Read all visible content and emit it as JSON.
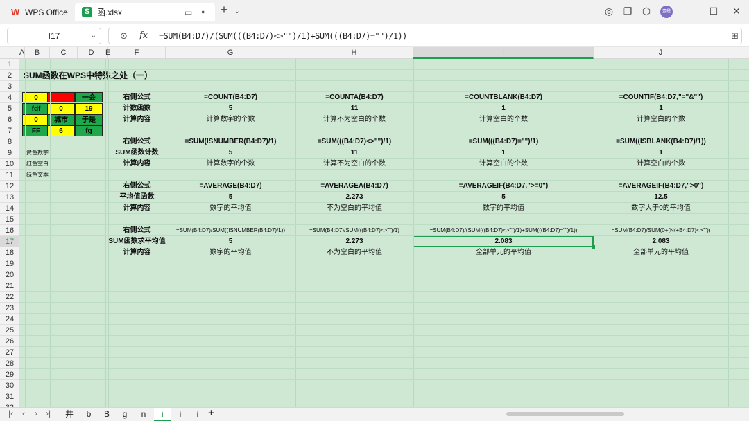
{
  "titlebar": {
    "app_tab": "WPS Office",
    "file_tab": "函.xlsx",
    "avatar_text": "壹橙"
  },
  "formula_bar": {
    "name_box": "I17",
    "formula": "=SUM(B4:D7)/(SUM(((B4:D7)<>\"\")/1)+SUM(((B4:D7)=\"\")/1))"
  },
  "columns": [
    "A",
    "B",
    "C",
    "D",
    "E",
    "F",
    "G",
    "H",
    "I",
    "J"
  ],
  "rows": [
    "1",
    "2",
    "3",
    "4",
    "5",
    "6",
    "7",
    "8",
    "9",
    "10",
    "11",
    "12",
    "13",
    "14",
    "15",
    "16",
    "17",
    "18",
    "19",
    "20",
    "21",
    "22",
    "23",
    "24",
    "25",
    "26",
    "27",
    "28",
    "29",
    "30",
    "31",
    "32"
  ],
  "title": "SUM函数在WPS中特殊之处（一）",
  "sample_table": [
    [
      "0",
      "",
      "一会"
    ],
    [
      "fdf",
      "0",
      "19"
    ],
    [
      "0",
      "城市",
      "于是"
    ],
    [
      "FF",
      "6",
      "fg"
    ]
  ],
  "legend": [
    "黄色数字",
    "红色空白",
    "绿色文本"
  ],
  "blocks": [
    {
      "labels": [
        "右侧公式",
        "计数函数",
        "计算内容"
      ],
      "formulas": [
        "=COUNT(B4:D7)",
        "=COUNTA(B4:D7)",
        "=COUNTBLANK(B4:D7)",
        "=COUNTIF(B4:D7,\"=\"&\"\")"
      ],
      "values": [
        "5",
        "11",
        "1",
        "1"
      ],
      "desc": [
        "计算数字的个数",
        "计算不为空白的个数",
        "计算空白的个数",
        "计算空白的个数"
      ]
    },
    {
      "labels": [
        "右侧公式",
        "SUM函数计数",
        "计算内容"
      ],
      "formulas": [
        "=SUM(ISNUMBER(B4:D7)/1)",
        "=SUM(((B4:D7)<>\"\")/1)",
        "=SUM(((B4:D7)=\"\")/1)",
        "=SUM((ISBLANK(B4:D7)/1))"
      ],
      "values": [
        "5",
        "11",
        "1",
        "1"
      ],
      "desc": [
        "计算数字的个数",
        "计算不为空白的个数",
        "计算空白的个数",
        "计算空白的个数"
      ]
    },
    {
      "labels": [
        "右侧公式",
        "平均值函数",
        "计算内容"
      ],
      "formulas": [
        "=AVERAGE(B4:D7)",
        "=AVERAGEA(B4:D7)",
        "=AVERAGEIF(B4:D7,\">=0\")",
        "=AVERAGEIF(B4:D7,\">0\")"
      ],
      "values": [
        "5",
        "2.273",
        "5",
        "12.5"
      ],
      "desc": [
        "数字的平均值",
        "不为空白的平均值",
        "数字的平均值",
        "数字大于0的平均值"
      ]
    },
    {
      "labels": [
        "右侧公式",
        "SUM函数求平均值",
        "计算内容"
      ],
      "formulas": [
        "=SUM(B4:D7)/SUM((ISNUMBER(B4:D7)/1))",
        "=SUM(B4:D7)/SUM(((B4:D7)<>\"\")/1)",
        "=SUM(B4:D7)/(SUM(((B4:D7)<>\"\")/1)+SUM(((B4:D7)=\"\")/1))",
        "=SUM(B4:D7)/SUM(0+(N(+B4:D7)<>\"\"))"
      ],
      "values": [
        "5",
        "2.273",
        "2.083",
        "2.083"
      ],
      "desc": [
        "数字的平均值",
        "不为空白的平均值",
        "全部单元的平均值",
        "全部单元的平均值"
      ]
    }
  ],
  "sheets": [
    "井",
    "b",
    "B",
    "g",
    "n",
    "i",
    "i",
    "i"
  ],
  "active_sheet_index": 5,
  "colors": {
    "yellow": "#ffff00",
    "red": "#ff0000",
    "green": "#1ea84a",
    "accent": "#1c9d4f"
  },
  "icons": [
    "wps-logo-icon",
    "sheet-icon",
    "monitor-icon",
    "dot-icon",
    "close-icon",
    "plus-icon",
    "chevron-down-icon",
    "colorful-ai-icon",
    "copy-window-icon",
    "cube-icon",
    "minimize-icon",
    "maximize-icon",
    "zoom-icon",
    "fx-icon",
    "expand-icon"
  ]
}
